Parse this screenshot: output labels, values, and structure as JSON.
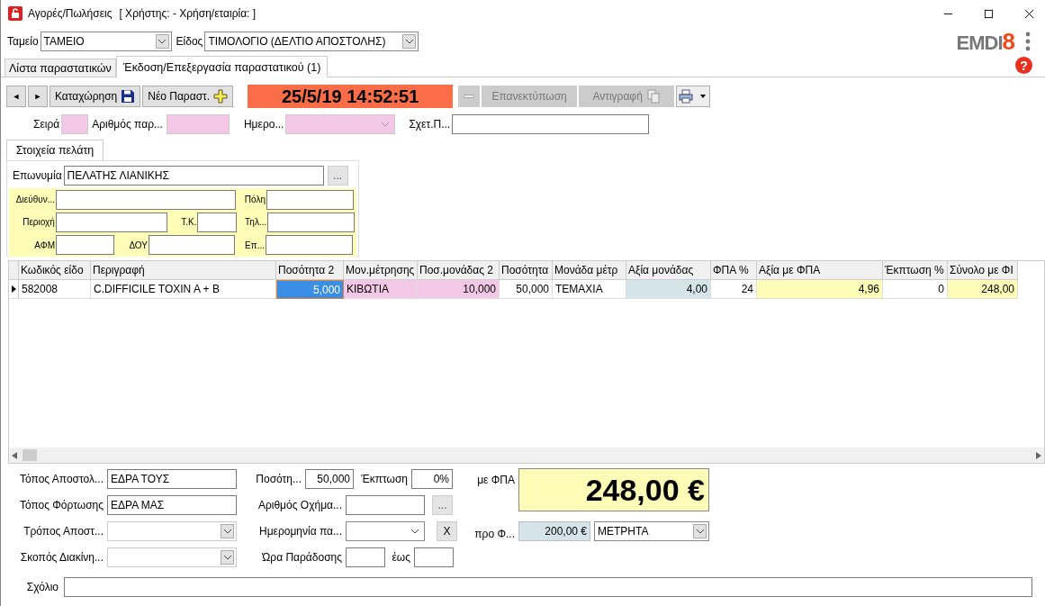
{
  "window": {
    "title": "Αγορές/Πωλήσεις",
    "subtitle": "[ Χρήστης: - Χρήση/εταιρία: ]"
  },
  "header": {
    "cashier_label": "Ταμείο",
    "cashier": "ΤΑΜΕΙΟ",
    "type_label": "Είδος",
    "type": "ΤΙΜΟΛΟΓΙΟ (ΔΕΛΤΙΟ ΑΠΟΣΤΟΛΗΣ)",
    "logo": "EMDI",
    "logo_accent": "8",
    "help": "?"
  },
  "tabs": [
    {
      "label": "Λίστα παραστατικών",
      "selected": false
    },
    {
      "label": "Έκδοση/Επεξεργασία παραστατικού (1)",
      "selected": true
    }
  ],
  "toolbar": {
    "prev": "◄",
    "next": "►",
    "save": "Καταχώρηση",
    "new": "Νέο Παραστ.",
    "clock": "25/5/19 14:52:51",
    "actions": [
      {
        "kind": "minus",
        "disabled": true
      },
      {
        "kind": "text",
        "label": "Επανεκτύπωση",
        "disabled": true
      },
      {
        "kind": "copy",
        "label": "Αντιγραφή",
        "disabled": true
      },
      {
        "kind": "print",
        "disabled": false
      }
    ]
  },
  "doc_fields": [
    {
      "label": "Σειρά",
      "kind": "field",
      "required": true
    },
    {
      "label": "Αριθμός παρ...",
      "kind": "field",
      "required": true
    },
    {
      "label": "Ημερο...",
      "kind": "combo",
      "required": true
    },
    {
      "label": "Σχετ.Π...",
      "kind": "field",
      "required": false
    }
  ],
  "customer": {
    "tab": "Στοιχεία πελάτη",
    "name_label": "Επωνυμία",
    "name": "ΠΕΛΑΤΗΣ ΛΙΑΝΙΚΗΣ",
    "browse": "...",
    "address_label": "Διεύθυν...",
    "city_label": "Πόλη",
    "area_label": "Περιοχή",
    "zip_label": "Τ.Κ.",
    "phone_label": "Τηλ...",
    "vat_label": "ΑΦΜ",
    "tax_office_label": "ΔΟΥ",
    "job_label": "Επ..."
  },
  "table": {
    "columns": [
      {
        "label": "Κωδικός είδο",
        "kind": "text"
      },
      {
        "label": "Περιγραφή",
        "kind": "text"
      },
      {
        "label": "Ποσότητα 2",
        "kind": "number"
      },
      {
        "label": "Μον.μέτρησης",
        "kind": "text",
        "color": "#f2c8e6"
      },
      {
        "label": "Ποσ.μονάδας 2",
        "kind": "number",
        "color": "#f2c8e6"
      },
      {
        "label": "Ποσότητα",
        "kind": "number"
      },
      {
        "label": "Μονάδα μέτρ",
        "kind": "text"
      },
      {
        "label": "Αξία μονάδας",
        "kind": "number",
        "color": "#d4e4e8"
      },
      {
        "label": "ΦΠΑ %",
        "kind": "number"
      },
      {
        "label": "Αξία με ΦΠΑ",
        "kind": "number",
        "color": "#fdfdb8"
      },
      {
        "label": "Έκπτωση %",
        "kind": "number"
      },
      {
        "label": "Σύνολο με ΦΙ",
        "kind": "number",
        "color": "#fdfdb8"
      }
    ],
    "rows": [
      {
        "current": true,
        "cells": [
          {
            "text": "582008",
            "selected": false
          },
          {
            "text": "C.DIFFICILE TOXIN A + B",
            "selected": false
          },
          {
            "text": "5,000",
            "selected": true
          },
          {
            "text": "ΚΙΒΩΤΙΑ",
            "selected": false
          },
          {
            "text": "10,000",
            "selected": false
          },
          {
            "text": "50,000",
            "selected": false
          },
          {
            "text": "ΤΕΜΑΧΙΑ",
            "selected": false
          },
          {
            "text": "4,00",
            "selected": false
          },
          {
            "text": "24",
            "selected": false
          },
          {
            "text": "4,96",
            "selected": false
          },
          {
            "text": "0",
            "selected": false
          },
          {
            "text": "248,00",
            "selected": false
          }
        ]
      }
    ]
  },
  "shipping": {
    "from_label": "Τόπος Αποστολ...",
    "from": "ΕΔΡΑ ΤΟΥΣ",
    "load_label": "Τόπος Φόρτωσης",
    "load": "ΕΔΡΑ ΜΑΣ",
    "method_label": "Τρόπος Αποστ...",
    "purpose_label": "Σκοπός Διακίνη...",
    "qty_label": "Ποσότη...",
    "qty": "50,000",
    "discount_label": "Έκπτωση",
    "discount": "0%",
    "vehicle_label": "Αριθμός Οχήμα...",
    "vehicle_browse": "...",
    "date_label": "Ημερομηνία πα...",
    "date_clear": "X",
    "time_label": "Ώρα Παράδοσης",
    "until_label": "έως"
  },
  "totals": {
    "gross_label": "με ΦΠΑ",
    "gross": "248,00 €",
    "net_label": "προ Φ...",
    "net": "200,00 €",
    "payment": "ΜΕΤΡΗΤΑ"
  },
  "comment_label": "Σχόλιο"
}
